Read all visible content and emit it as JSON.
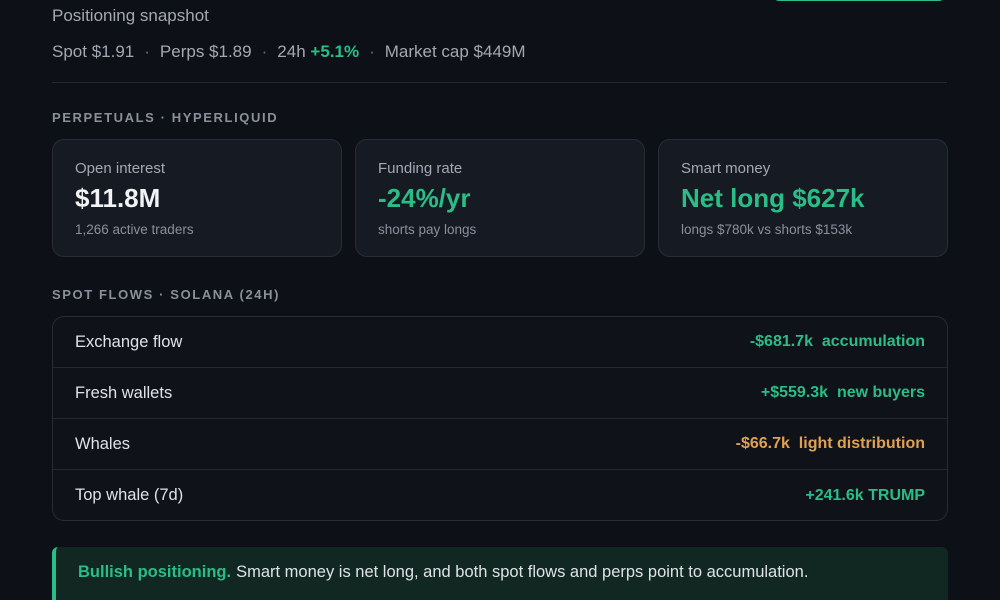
{
  "header": {
    "subtitle": "Positioning snapshot",
    "stats": {
      "spot": "Spot $1.91",
      "perps": "Perps $1.89",
      "change_label": "24h",
      "change_value": "+5.1%",
      "market_cap": "Market cap $449M",
      "separator": "·"
    }
  },
  "perpetuals": {
    "section_label": "PERPETUALS · HYPERLIQUID",
    "cards": [
      {
        "label": "Open interest",
        "value": "$11.8M",
        "sub": "1,266 active traders"
      },
      {
        "label": "Funding rate",
        "value": "-24%/yr",
        "sub": "shorts pay longs"
      },
      {
        "label": "Smart money",
        "value": "Net long $627k",
        "sub": "longs $780k vs shorts $153k"
      }
    ]
  },
  "spot_flows": {
    "section_label": "SPOT FLOWS · SOLANA (24H)",
    "rows": [
      {
        "label": "Exchange flow",
        "value": "-$681.7k  accumulation"
      },
      {
        "label": "Fresh wallets",
        "value": "+$559.3k  new buyers"
      },
      {
        "label": "Whales",
        "value": "-$66.7k  light distribution"
      },
      {
        "label": "Top whale (7d)",
        "value": "+241.6k TRUMP"
      }
    ]
  },
  "callout": {
    "title": "Bullish positioning.",
    "text": "Smart money is net long, and both spot flows and perps point to accumulation."
  },
  "colors": {
    "positive": "#2bbd86",
    "caution": "#e0a252",
    "background": "#0d1016"
  }
}
